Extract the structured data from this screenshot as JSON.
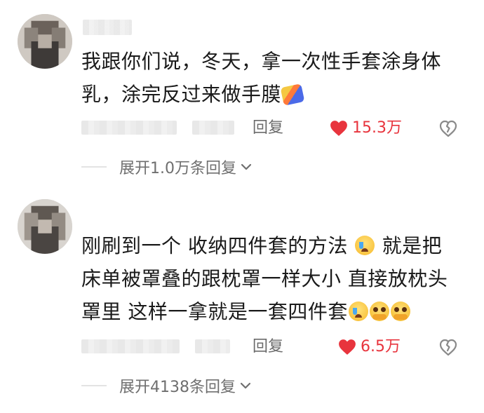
{
  "comments": [
    {
      "text_parts": [
        "我跟你们说，冬天，拿一次性手套涂身体乳，涂完反过来做手膜"
      ],
      "emoji_after": [
        "mask-emoji"
      ],
      "reply_label": "回复",
      "likes": "15.3万",
      "expand_label": "展开1.0万条回复"
    },
    {
      "text_a": "刚刷到一个 收纳四件套的方法",
      "text_b": "就是把床单被罩叠的跟枕罩一样大小 直接放枕头罩里  这样一拿就是一套四件套",
      "reply_label": "回复",
      "likes": "6.5万",
      "expand_label": "展开4138条回复"
    }
  ],
  "colors": {
    "like_red": "#e8343d",
    "meta_gray": "#6b6b6b"
  }
}
